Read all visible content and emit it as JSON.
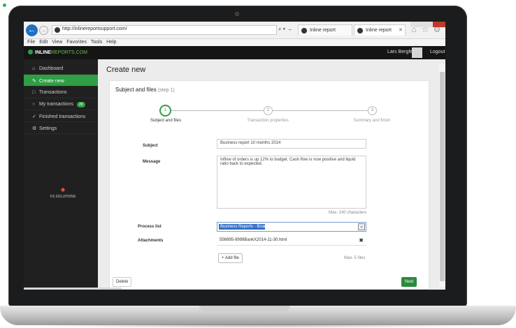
{
  "browser": {
    "url": "http://inlinereportsupport.com/",
    "search_controls": "⌕ ▾ →",
    "tabs": [
      {
        "label": "Inline report"
      },
      {
        "label": "Inline report"
      }
    ],
    "menu": [
      "File",
      "Edit",
      "View",
      "Favorites",
      "Tools",
      "Help"
    ]
  },
  "app": {
    "logo_main": "INLINE",
    "logo_accent": "REPORTS.COM",
    "user_name": "Lars Bergfelt",
    "logout_label": "Logout"
  },
  "sidebar": {
    "items": [
      {
        "label": "Dashboard",
        "icon": "home-icon"
      },
      {
        "label": "Create new",
        "icon": "pencil-icon"
      },
      {
        "label": "Transactions",
        "icon": "folder-icon"
      },
      {
        "label": "My transactions",
        "icon": "person-icon",
        "badge": "28"
      },
      {
        "label": "Finished transactions",
        "icon": "check-icon"
      },
      {
        "label": "Settings",
        "icon": "gear-icon"
      }
    ],
    "company": "FS SOLUTIONS"
  },
  "page": {
    "title": "Create new",
    "card_title": "Subject and files",
    "card_step": "(step 1)"
  },
  "steps": [
    {
      "number": "1",
      "label": "Subject and files"
    },
    {
      "number": "2",
      "label": "Transaction properties"
    },
    {
      "number": "3",
      "label": "Summary and finish"
    }
  ],
  "form": {
    "subject_label": "Subject",
    "subject_value": "Business report 10 months 2014",
    "message_label": "Message",
    "message_value": "Inflow of orders is up 12% to budget. Cash flow is now positive and liquid ratio back to expected.",
    "char_hint": "Max. 140 characters",
    "process_label": "Process list",
    "process_value": "Business Reports - Board",
    "attachments_label": "Attachments",
    "attachment_file": "556995-9999BankX2014-11-30.html",
    "add_file_label": "Add file",
    "max_files_hint": "Max. 5 files",
    "delete_label": "Delete",
    "next_label": "Next"
  },
  "colors": {
    "accent": "#2f9e44",
    "sidebar_bg": "#202020",
    "header_bg": "#151515",
    "select_highlight": "#3370c9"
  }
}
